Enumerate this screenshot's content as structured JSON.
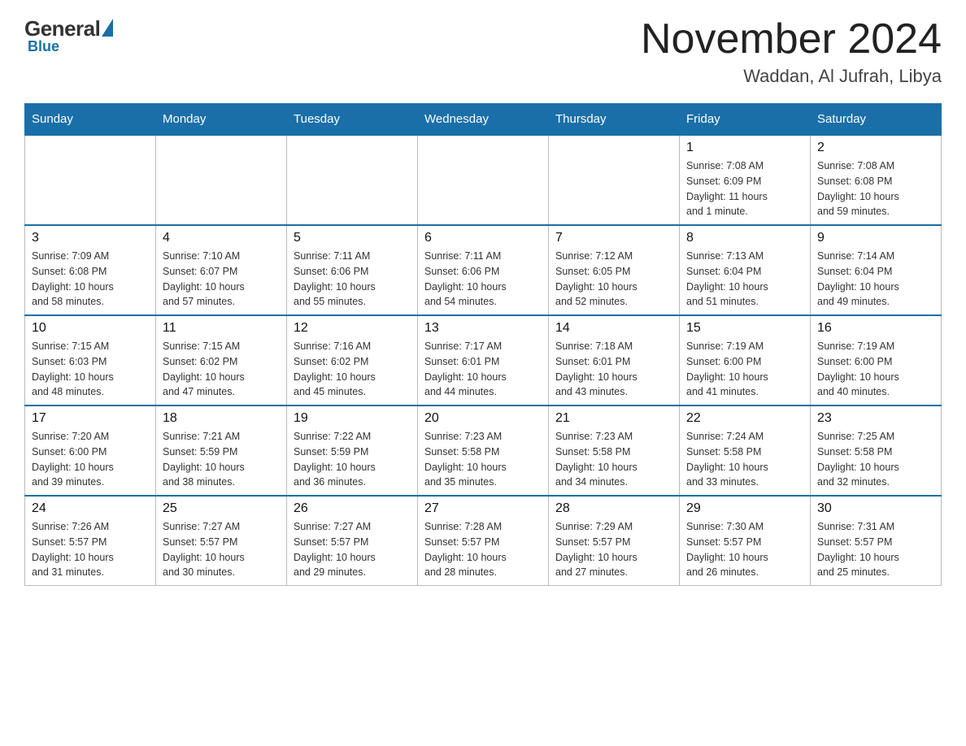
{
  "header": {
    "logo_general": "General",
    "logo_blue": "Blue",
    "month_year": "November 2024",
    "location": "Waddan, Al Jufrah, Libya"
  },
  "days_of_week": [
    "Sunday",
    "Monday",
    "Tuesday",
    "Wednesday",
    "Thursday",
    "Friday",
    "Saturday"
  ],
  "weeks": [
    {
      "days": [
        {
          "number": "",
          "info": ""
        },
        {
          "number": "",
          "info": ""
        },
        {
          "number": "",
          "info": ""
        },
        {
          "number": "",
          "info": ""
        },
        {
          "number": "",
          "info": ""
        },
        {
          "number": "1",
          "info": "Sunrise: 7:08 AM\nSunset: 6:09 PM\nDaylight: 11 hours\nand 1 minute."
        },
        {
          "number": "2",
          "info": "Sunrise: 7:08 AM\nSunset: 6:08 PM\nDaylight: 10 hours\nand 59 minutes."
        }
      ]
    },
    {
      "days": [
        {
          "number": "3",
          "info": "Sunrise: 7:09 AM\nSunset: 6:08 PM\nDaylight: 10 hours\nand 58 minutes."
        },
        {
          "number": "4",
          "info": "Sunrise: 7:10 AM\nSunset: 6:07 PM\nDaylight: 10 hours\nand 57 minutes."
        },
        {
          "number": "5",
          "info": "Sunrise: 7:11 AM\nSunset: 6:06 PM\nDaylight: 10 hours\nand 55 minutes."
        },
        {
          "number": "6",
          "info": "Sunrise: 7:11 AM\nSunset: 6:06 PM\nDaylight: 10 hours\nand 54 minutes."
        },
        {
          "number": "7",
          "info": "Sunrise: 7:12 AM\nSunset: 6:05 PM\nDaylight: 10 hours\nand 52 minutes."
        },
        {
          "number": "8",
          "info": "Sunrise: 7:13 AM\nSunset: 6:04 PM\nDaylight: 10 hours\nand 51 minutes."
        },
        {
          "number": "9",
          "info": "Sunrise: 7:14 AM\nSunset: 6:04 PM\nDaylight: 10 hours\nand 49 minutes."
        }
      ]
    },
    {
      "days": [
        {
          "number": "10",
          "info": "Sunrise: 7:15 AM\nSunset: 6:03 PM\nDaylight: 10 hours\nand 48 minutes."
        },
        {
          "number": "11",
          "info": "Sunrise: 7:15 AM\nSunset: 6:02 PM\nDaylight: 10 hours\nand 47 minutes."
        },
        {
          "number": "12",
          "info": "Sunrise: 7:16 AM\nSunset: 6:02 PM\nDaylight: 10 hours\nand 45 minutes."
        },
        {
          "number": "13",
          "info": "Sunrise: 7:17 AM\nSunset: 6:01 PM\nDaylight: 10 hours\nand 44 minutes."
        },
        {
          "number": "14",
          "info": "Sunrise: 7:18 AM\nSunset: 6:01 PM\nDaylight: 10 hours\nand 43 minutes."
        },
        {
          "number": "15",
          "info": "Sunrise: 7:19 AM\nSunset: 6:00 PM\nDaylight: 10 hours\nand 41 minutes."
        },
        {
          "number": "16",
          "info": "Sunrise: 7:19 AM\nSunset: 6:00 PM\nDaylight: 10 hours\nand 40 minutes."
        }
      ]
    },
    {
      "days": [
        {
          "number": "17",
          "info": "Sunrise: 7:20 AM\nSunset: 6:00 PM\nDaylight: 10 hours\nand 39 minutes."
        },
        {
          "number": "18",
          "info": "Sunrise: 7:21 AM\nSunset: 5:59 PM\nDaylight: 10 hours\nand 38 minutes."
        },
        {
          "number": "19",
          "info": "Sunrise: 7:22 AM\nSunset: 5:59 PM\nDaylight: 10 hours\nand 36 minutes."
        },
        {
          "number": "20",
          "info": "Sunrise: 7:23 AM\nSunset: 5:58 PM\nDaylight: 10 hours\nand 35 minutes."
        },
        {
          "number": "21",
          "info": "Sunrise: 7:23 AM\nSunset: 5:58 PM\nDaylight: 10 hours\nand 34 minutes."
        },
        {
          "number": "22",
          "info": "Sunrise: 7:24 AM\nSunset: 5:58 PM\nDaylight: 10 hours\nand 33 minutes."
        },
        {
          "number": "23",
          "info": "Sunrise: 7:25 AM\nSunset: 5:58 PM\nDaylight: 10 hours\nand 32 minutes."
        }
      ]
    },
    {
      "days": [
        {
          "number": "24",
          "info": "Sunrise: 7:26 AM\nSunset: 5:57 PM\nDaylight: 10 hours\nand 31 minutes."
        },
        {
          "number": "25",
          "info": "Sunrise: 7:27 AM\nSunset: 5:57 PM\nDaylight: 10 hours\nand 30 minutes."
        },
        {
          "number": "26",
          "info": "Sunrise: 7:27 AM\nSunset: 5:57 PM\nDaylight: 10 hours\nand 29 minutes."
        },
        {
          "number": "27",
          "info": "Sunrise: 7:28 AM\nSunset: 5:57 PM\nDaylight: 10 hours\nand 28 minutes."
        },
        {
          "number": "28",
          "info": "Sunrise: 7:29 AM\nSunset: 5:57 PM\nDaylight: 10 hours\nand 27 minutes."
        },
        {
          "number": "29",
          "info": "Sunrise: 7:30 AM\nSunset: 5:57 PM\nDaylight: 10 hours\nand 26 minutes."
        },
        {
          "number": "30",
          "info": "Sunrise: 7:31 AM\nSunset: 5:57 PM\nDaylight: 10 hours\nand 25 minutes."
        }
      ]
    }
  ]
}
